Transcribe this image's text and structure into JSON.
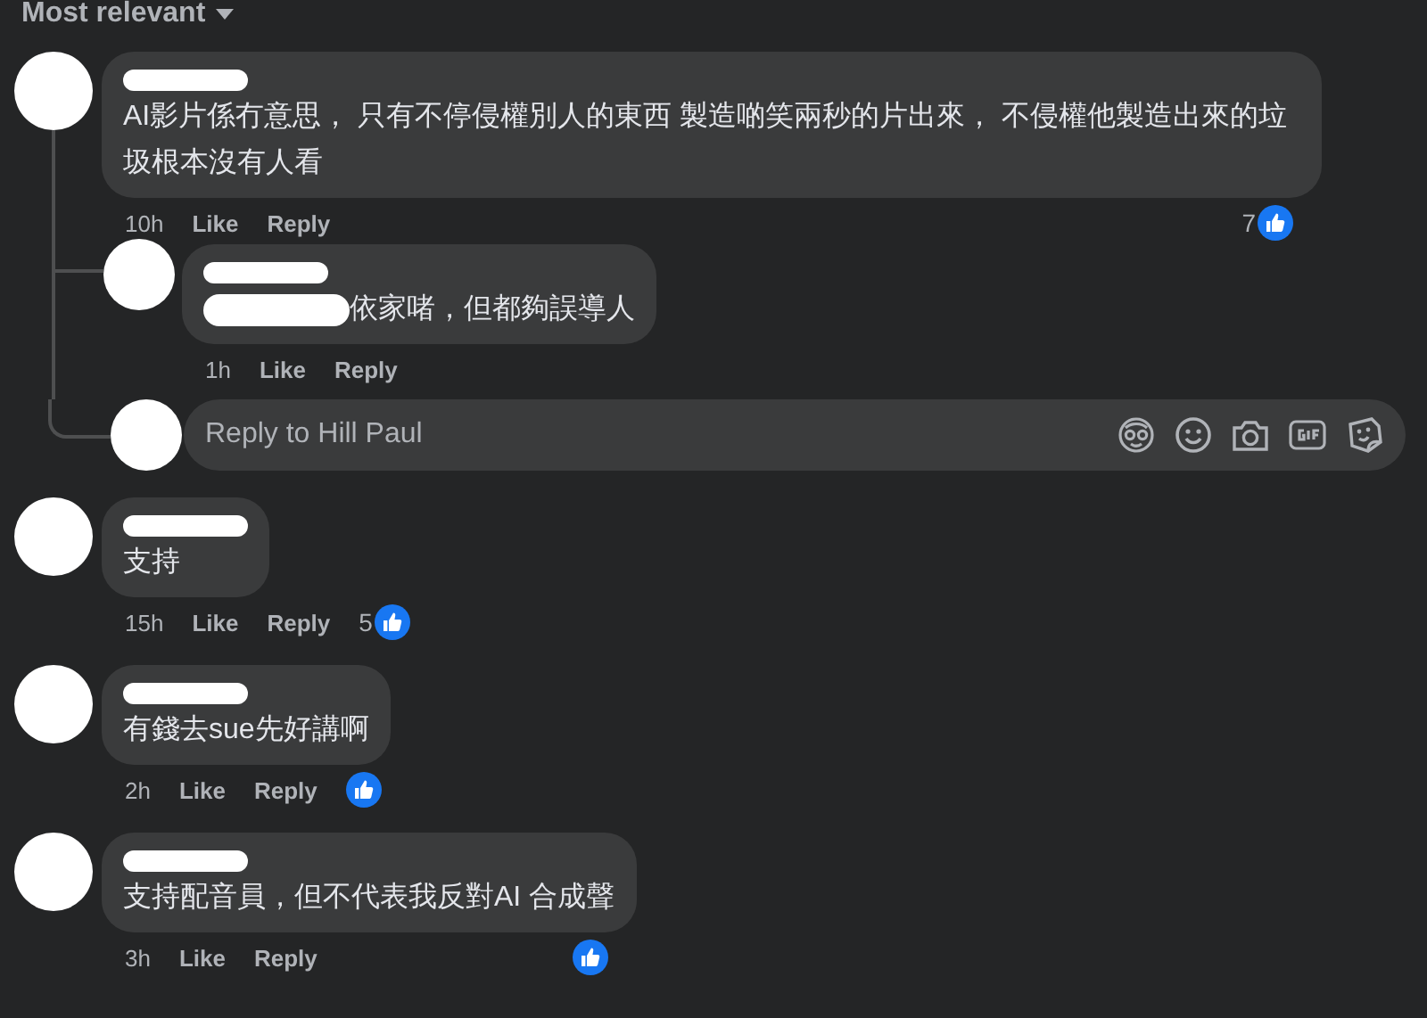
{
  "sort": {
    "label": "Most relevant"
  },
  "comments": [
    {
      "name_redacted": true,
      "text": "AI影片係冇意思， 只有不停侵權別人的東西 製造啲笑兩秒的片出來， 不侵權他製造出來的垃圾根本沒有人看",
      "time": "10h",
      "like": "Like",
      "reply": "Reply",
      "reaction_icon": true,
      "reaction_count": "7",
      "replies": [
        {
          "name_redacted": true,
          "text_prefix_redacted": true,
          "text": "依家啫，但都夠誤導人",
          "time": "1h",
          "like": "Like",
          "reply": "Reply"
        }
      ],
      "composer": {
        "placeholder": "Reply to Hill Paul"
      }
    },
    {
      "name_redacted": true,
      "text": "支持",
      "time": "15h",
      "like": "Like",
      "reply": "Reply",
      "reaction_icon": true,
      "reaction_count": "5"
    },
    {
      "name_redacted": true,
      "text": "有錢去sue先好講啊",
      "time": "2h",
      "like": "Like",
      "reply": "Reply",
      "reaction_icon": true
    },
    {
      "name_redacted": true,
      "text": "支持配音員，但不代表我反對AI 合成聲",
      "time": "3h",
      "like": "Like",
      "reply": "Reply",
      "reaction_icon": true
    }
  ]
}
